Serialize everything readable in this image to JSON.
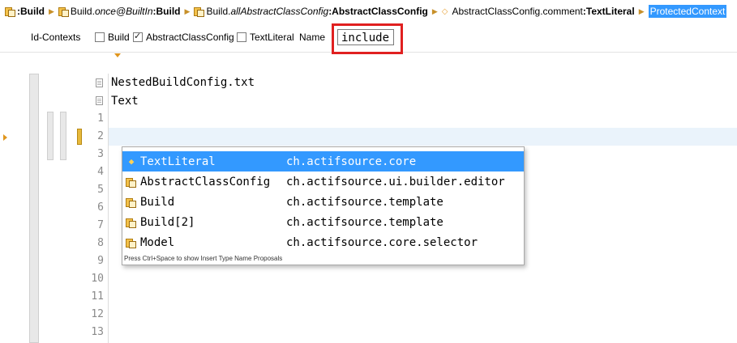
{
  "breadcrumb": [
    {
      "prefix": "",
      "italic": "",
      "bold": ":Build",
      "icon": "class-icon"
    },
    {
      "prefix": "Build.",
      "italic": "once@BuiltIn",
      "bold": ":Build",
      "icon": "class-icon"
    },
    {
      "prefix": "Build.",
      "italic": "allAbstractClassConfig",
      "bold": ":AbstractClassConfig",
      "icon": "class-icon"
    },
    {
      "prefix": "AbstractClassConfig.comment",
      "italic": "",
      "bold": ":TextLiteral",
      "icon": "diamond-icon"
    },
    {
      "prefix": "",
      "italic": "",
      "bold": "ProtectedContext",
      "icon": "none",
      "selected": true
    }
  ],
  "toolbar": {
    "id_contexts_label": "Id-Contexts",
    "build_label": "Build",
    "build_checked": false,
    "abstract_label": "AbstractClassConfig",
    "abstract_checked": true,
    "textliteral_label": "TextLiteral",
    "textliteral_checked": false,
    "name_label": "Name",
    "name_value": "include"
  },
  "editor": {
    "header_lines": [
      "NestedBuildConfig.txt",
      "Text"
    ],
    "line_numbers": [
      "1",
      "2",
      "3",
      "4",
      "5",
      "6",
      "7",
      "8",
      "9",
      "10",
      "11",
      "12",
      "13"
    ]
  },
  "proposals": {
    "items": [
      {
        "name": "TextLiteral",
        "package": "ch.actifsource.core",
        "icon": "diamond-icon",
        "selected": true
      },
      {
        "name": "AbstractClassConfig",
        "package": "ch.actifsource.ui.builder.editor",
        "icon": "class-icon"
      },
      {
        "name": "Build",
        "package": "ch.actifsource.template",
        "icon": "class-icon"
      },
      {
        "name": "Build[2]",
        "package": "ch.actifsource.template",
        "icon": "class-icon"
      },
      {
        "name": "Model",
        "package": "ch.actifsource.core.selector",
        "icon": "class-icon"
      }
    ],
    "hint": "Press Ctrl+Space to show Insert Type Name Proposals"
  },
  "colors": {
    "accent": "#3399ff",
    "highlight": "#e02020",
    "marker": "#e0961e"
  }
}
